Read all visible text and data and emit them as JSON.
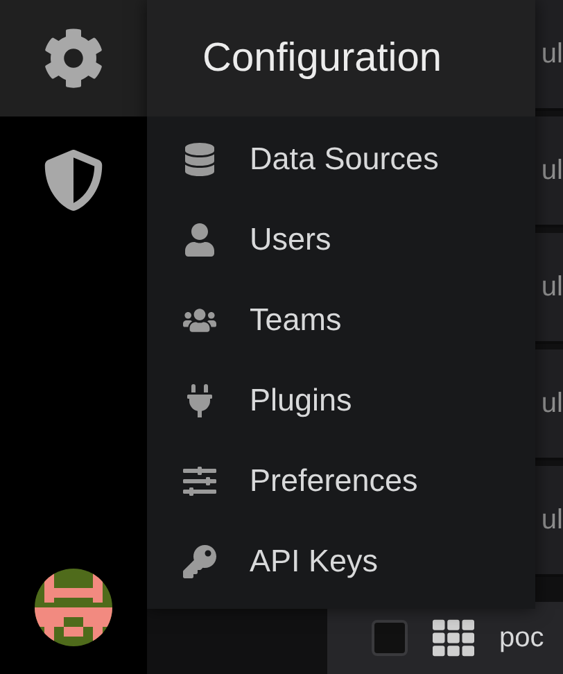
{
  "sidebar": {
    "items": [
      {
        "kind": "gear",
        "selected": true
      },
      {
        "kind": "shield",
        "selected": false
      }
    ]
  },
  "menu": {
    "title": "Configuration",
    "items": [
      {
        "kind": "database",
        "label": "Data Sources"
      },
      {
        "kind": "user",
        "label": "Users"
      },
      {
        "kind": "users",
        "label": "Teams"
      },
      {
        "kind": "plug",
        "label": "Plugins"
      },
      {
        "kind": "sliders",
        "label": "Preferences"
      },
      {
        "kind": "key",
        "label": "API Keys"
      }
    ]
  },
  "dashboard": {
    "rows": [
      {
        "text": "ul"
      },
      {
        "text": "ul"
      },
      {
        "text": "ul"
      },
      {
        "text": "ul"
      },
      {
        "text": "ul"
      }
    ],
    "bottom_row": {
      "checked": false,
      "text": "poc"
    }
  }
}
